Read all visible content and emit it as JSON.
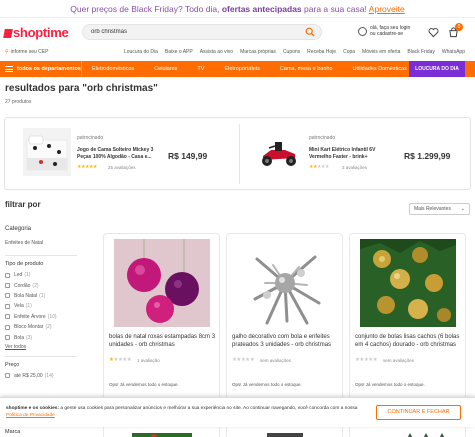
{
  "promo": {
    "lead": "Quer preços de Black Friday?",
    "middle": "Todo dia,",
    "bold": "ofertas antecipadas",
    "tail": "para a sua casa!",
    "link": "Aproveite"
  },
  "header": {
    "logo": "shoptime",
    "search_value": "orb christmas",
    "user_line1": "olá, faça seu login",
    "user_line2": "ou cadastre-se",
    "cart_count": "0"
  },
  "subheader": {
    "cep": "informe seu CEP",
    "links": [
      "Loucura do Dia",
      "Baixe o APP",
      "Assista ao vivo",
      "Marcas próprias",
      "Cupons",
      "Receba Hoje",
      "Copa",
      "Móveis em oferta",
      "Black Friday",
      "WhatsApp"
    ]
  },
  "nav": {
    "all_categories": "todos os departamentos",
    "items": [
      "Eletrodomésticos",
      "Celulares",
      "TV",
      "Eletroportáteis",
      "Cama, mesa e banho",
      "Utilidades Domésticas"
    ],
    "highlight": "LOUCURA DO DIA"
  },
  "results": {
    "title": "resultados para \"orb christmas\"",
    "count": "27 produtos"
  },
  "sponsored": [
    {
      "label": "patrocinado",
      "name": "Jogo de Cama Solteiro Mickey 3 Peças 100% Algodão - Casa e...",
      "stars": "★★★★★",
      "reviews": "25 avaliações",
      "price": "R$ 149,99"
    },
    {
      "label": "patrocinado",
      "name": "Mini Kart Elétrico Infantil 6V Vermelho Faster - brink+",
      "stars": "★★",
      "empty_stars": "★★★",
      "reviews": "3 avaliações",
      "price": "R$ 1.299,99"
    }
  ],
  "filters": {
    "title": "filtrar por",
    "order": "Mais Relevantes",
    "category_heading": "Categoria",
    "category_link": "Enfeites de Natal",
    "type_heading": "Tipo de produto",
    "types": [
      {
        "label": "Led",
        "count": "(1)"
      },
      {
        "label": "Cordão",
        "count": "(2)"
      },
      {
        "label": "Bola Natal",
        "count": "(1)"
      },
      {
        "label": "Vela",
        "count": "(1)"
      },
      {
        "label": "Enfeite Árvore",
        "count": "(10)"
      },
      {
        "label": "Bloco Montar",
        "count": "(2)"
      },
      {
        "label": "Bola",
        "count": "(3)"
      }
    ],
    "more": "Ver todos",
    "price_heading": "Preço",
    "price_option": {
      "label": "até R$ 25,00",
      "count": "(14)"
    },
    "brand_heading": "Marca"
  },
  "products": [
    {
      "name": "bolas de natal roxas estampadas 8cm 3 unidades - orb christmas",
      "stars": "★",
      "empty_stars": "★★★★",
      "reviews": "1 avaliação",
      "oops": "Ops! Já vendemos todo o estoque."
    },
    {
      "name": "galho decorativo com bola e enfeites prateados 3 unidades - orb christmas",
      "stars": "",
      "empty_stars": "★★★★★",
      "reviews": "sem avaliações",
      "oops": "Ops! Já vendemos todo o estoque."
    },
    {
      "name": "conjunto de bolas lisas cachos (6 bolas em 4 cachos) dourado - orb christmas",
      "stars": "",
      "empty_stars": "★★★★★",
      "reviews": "sem avaliações",
      "oops": "Ops! Já vendemos todo o estoque."
    }
  ],
  "cookie": {
    "bold": "shoptime e os cookies:",
    "text": "a gente usa cookies para personalizar anúncios e melhorar a sua experiência no site. Ao continuar navegando, você concorda com a nossa",
    "policy": "Política de Privacidade",
    "button": "CONTINUAR E FECHAR"
  },
  "colors": {
    "brand": "#ff1f3d",
    "accent": "#ff6d00",
    "highlight": "#7b2ed6",
    "stars": "#ffb400"
  }
}
